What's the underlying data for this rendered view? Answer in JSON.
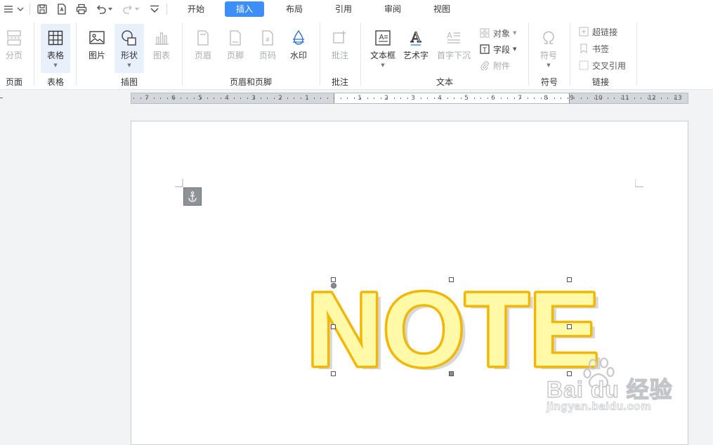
{
  "tabs": [
    "开始",
    "插入",
    "布局",
    "引用",
    "审阅",
    "视图"
  ],
  "active_tab": "插入",
  "ribbon": {
    "page_break": "分页",
    "table": "表格",
    "picture": "图片",
    "shape": "形状",
    "chart": "图表",
    "header": "页眉",
    "footer": "页脚",
    "page_number": "页码",
    "watermark": "水印",
    "comment": "批注",
    "textbox": "文本框",
    "wordart": "艺术字",
    "drop_cap": "首字下沉",
    "object": "对象",
    "field": "字段",
    "attachment": "附件",
    "symbol": "符号",
    "hyperlink": "超链接",
    "bookmark": "书签",
    "cross_reference": "交叉引用"
  },
  "groups": {
    "page": "页面",
    "table": "表格",
    "illustrations": "插图",
    "header_footer": "页眉和页脚",
    "comments": "批注",
    "text": "文本",
    "symbols": "符号",
    "links": "链接"
  },
  "ruler": {
    "left_numbers": [
      "7",
      "6",
      "5",
      "4",
      "3",
      "2",
      "1"
    ],
    "main_numbers": [
      "1",
      "2",
      "3",
      "4",
      "5",
      "6",
      "7",
      "8",
      "9",
      "10",
      "11",
      "12",
      "13"
    ]
  },
  "document": {
    "wordart_text": "NOTE",
    "wordart_fill": "#fff9a8",
    "wordart_stroke": "#f2b705"
  },
  "watermark": {
    "brand": "Bai du 经验",
    "url": "jingyan.baidu.com"
  },
  "colors": {
    "accent": "#3e8ef7",
    "selected_ribbon_bg": "#e8f0fb"
  }
}
